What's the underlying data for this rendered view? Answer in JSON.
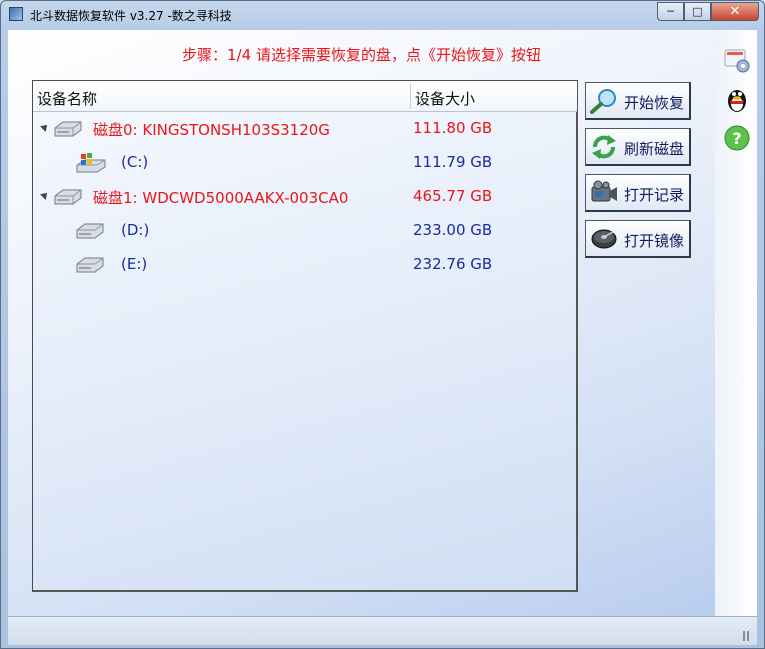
{
  "window": {
    "title": "北斗数据恢复软件 v3.27 -数之寻科技",
    "controls": {
      "minimize": "─",
      "maximize": "□",
      "close": "✕"
    }
  },
  "step_text": "步骤：1/4 请选择需要恢复的盘，点《开始恢复》按钮",
  "device_list": {
    "columns": [
      "设备名称",
      "设备大小"
    ],
    "rows": [
      {
        "type": "disk",
        "icon": "hard-drive-icon",
        "name": "磁盘0: KINGSTONSH103S3120G",
        "size": "111.80 GB",
        "color": "#e8161a"
      },
      {
        "type": "partition",
        "icon": "windows-drive-icon",
        "name": "(C:)",
        "size": "111.79 GB",
        "color": "#1a2c9c"
      },
      {
        "type": "disk",
        "icon": "hard-drive-icon",
        "name": "磁盘1: WDCWD5000AAKX-003CA0",
        "size": "465.77 GB",
        "color": "#e8161a"
      },
      {
        "type": "partition",
        "icon": "drive-icon",
        "name": "(D:)",
        "size": "233.00 GB",
        "color": "#1a2c9c"
      },
      {
        "type": "partition",
        "icon": "drive-icon",
        "name": "(E:)",
        "size": "232.76 GB",
        "color": "#1a2c9c"
      }
    ]
  },
  "actions": {
    "start": {
      "label": "开始恢复",
      "icon": "magnifier-icon"
    },
    "refresh": {
      "label": "刷新磁盘",
      "icon": "refresh-icon"
    },
    "open_record": {
      "label": "打开记录",
      "icon": "camera-icon"
    },
    "open_image": {
      "label": "打开镜像",
      "icon": "disk-image-icon"
    }
  },
  "side_icons": [
    "settings-icon",
    "qq-penguin-icon",
    "help-icon"
  ],
  "colors": {
    "accent_red": "#e8161a",
    "partition_blue": "#1a2c9c"
  }
}
